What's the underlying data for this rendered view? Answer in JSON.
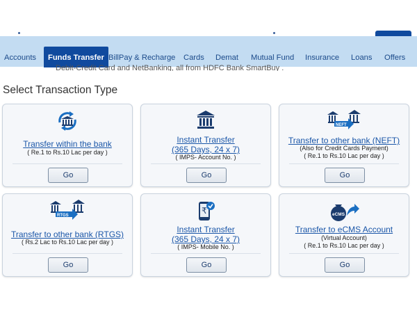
{
  "nav": {
    "items": [
      "Accounts",
      "Funds Transfer",
      "BillPay & Recharge",
      "Cards",
      "Demat",
      "Mutual Fund",
      "Insurance",
      "Loans",
      "Offers"
    ],
    "active": "Funds Transfer"
  },
  "subtext": "Debit-Credit Card and NetBanking, all from HDFC Bank SmartBuy .",
  "page_title": "Select Transaction Type",
  "cards": [
    {
      "icon": "bank-refresh-icon",
      "title_lines": [
        "Transfer within the bank"
      ],
      "sub_lines": [
        "( Re.1 to Rs.10 Lac per day )"
      ],
      "button": "Go"
    },
    {
      "icon": "bank-icon",
      "title_lines": [
        "Instant Transfer",
        "(365 Days, 24 x 7)"
      ],
      "sub_lines": [
        "( IMPS- Account No. )"
      ],
      "button": "Go"
    },
    {
      "icon": "neft-icon",
      "badge": "NEFT",
      "title_lines": [
        "Transfer to other bank (NEFT)"
      ],
      "sub_lines": [
        "(Also for Credit Cards Payment)",
        "( Re.1 to Rs.10 Lac per day )"
      ],
      "button": "Go"
    },
    {
      "icon": "rtgs-icon",
      "badge": "RTGS",
      "title_lines": [
        "Transfer to other bank (RTGS)"
      ],
      "sub_lines": [
        "( Rs.2 Lac to Rs.10 Lac per day )"
      ],
      "button": "Go"
    },
    {
      "icon": "mobile-rupee-icon",
      "title_lines": [
        "Instant Transfer",
        "(365 Days, 24 x 7)"
      ],
      "sub_lines": [
        "( IMPS- Mobile No. )"
      ],
      "button": "Go"
    },
    {
      "icon": "ecms-bag-icon",
      "badge": "eCMS",
      "title_lines": [
        "Transfer to eCMS Account"
      ],
      "sub_lines": [
        "(Virtual Account)",
        "( Re.1 to Rs.10 Lac per day )"
      ],
      "button": "Go"
    }
  ],
  "colors": {
    "nav_bg": "#c3dcf2",
    "nav_active": "#104a9e",
    "link": "#1a56a8",
    "icon": "#1b3c6e"
  }
}
